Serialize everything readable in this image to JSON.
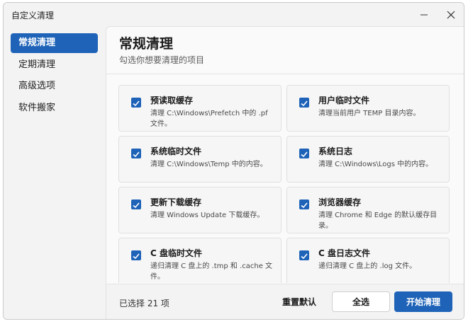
{
  "window": {
    "title": "自定义清理"
  },
  "sidebar": {
    "items": [
      {
        "label": "常规清理",
        "active": true
      },
      {
        "label": "定期清理",
        "active": false
      },
      {
        "label": "高级选项",
        "active": false
      },
      {
        "label": "软件搬家",
        "active": false
      }
    ]
  },
  "header": {
    "title": "常规清理",
    "subtitle": "勾选你想要清理的项目"
  },
  "cards": [
    {
      "title": "预读取缓存",
      "desc": "清理 C:\\Windows\\Prefetch 中的 .pf 文件。",
      "checked": true
    },
    {
      "title": "用户临时文件",
      "desc": "清理当前用户 TEMP 目录内容。",
      "checked": true
    },
    {
      "title": "系统临时文件",
      "desc": "清理 C:\\Windows\\Temp 中的内容。",
      "checked": true
    },
    {
      "title": "系统日志",
      "desc": "清理 C:\\Windows\\Logs 中的内容。",
      "checked": true
    },
    {
      "title": "更新下载缓存",
      "desc": "清理 Windows Update 下载缓存。",
      "checked": true
    },
    {
      "title": "浏览器缓存",
      "desc": "清理 Chrome 和 Edge 的默认缓存目录。",
      "checked": true
    },
    {
      "title": "C 盘临时文件",
      "desc": "递归清理 C 盘上的 .tmp 和 .cache 文件。",
      "checked": true
    },
    {
      "title": "C 盘日志文件",
      "desc": "递归清理 C 盘上的 .log 文件。",
      "checked": true
    }
  ],
  "footer": {
    "selected_count": "已选择 21 项",
    "reset_label": "重置默认",
    "select_all_label": "全选",
    "start_label": "开始清理"
  },
  "colors": {
    "accent": "#1e63b8"
  }
}
